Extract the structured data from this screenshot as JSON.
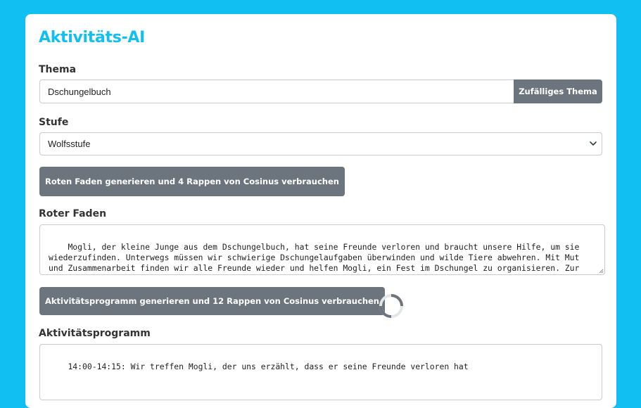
{
  "app": {
    "title": "Aktivitäts-AI"
  },
  "theme": {
    "label": "Thema",
    "value": "Dschungelbuch",
    "random_button_label": "Zufälliges Thema"
  },
  "level": {
    "label": "Stufe",
    "selected": "Wolfsstufe"
  },
  "red_thread": {
    "generate_button_label": "Roten Faden generieren und 4 Rappen von Cosinus verbrauchen",
    "label": "Roter Faden",
    "text": "Mogli, der kleine Junge aus dem Dschungelbuch, hat seine Freunde verloren und braucht unsere Hilfe, um sie wiederzufinden. Unterwegs müssen wir schwierige Dschungelaufgaben überwinden und wilde Tiere abwehren. Mit Mut und Zusammenarbeit finden wir alle Freunde wieder und helfen Mogli, ein Fest im Dschungel zu organisieren. Zur Feier des Tages gibt es dann leckeres Dschungel-Essen, das wir selbst zubereiten."
  },
  "program": {
    "generate_button_label": "Aktivitätsprogramm generieren und 12 Rappen von Cosinus verbrauchen",
    "label": "Aktivitätsprogramm",
    "text": "14:00-14:15: Wir treffen Mogli, der uns erzählt, dass er seine Freunde verloren hat"
  },
  "colors": {
    "background": "#12bff2",
    "accent": "#12bff2",
    "button": "#6c757d"
  },
  "icons": {
    "select_arrow": "chevron-down-icon",
    "loading": "loading-spinner-icon",
    "resize": "resize-handle-icon"
  }
}
